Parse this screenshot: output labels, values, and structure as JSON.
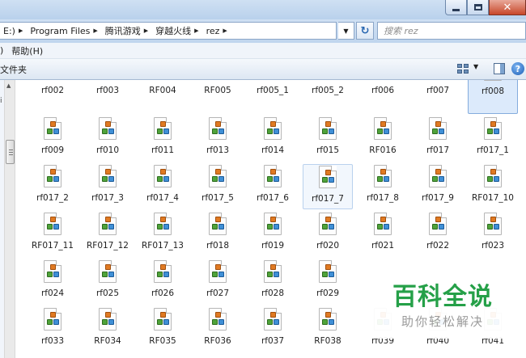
{
  "window": {
    "caption_buttons": [
      "minimize-icon",
      "maximize-icon",
      "close-icon"
    ]
  },
  "address": {
    "crumbs": [
      "E:)",
      "Program Files",
      "腾讯游戏",
      "穿越火线",
      "rez"
    ],
    "search_placeholder": "搜索 rez"
  },
  "menu": {
    "items": [
      ")",
      "帮助(H)"
    ]
  },
  "commandbar": {
    "left_label": "文件夹"
  },
  "files": {
    "rows": [
      [
        "rf002",
        "rf003",
        "RF004",
        "RF005",
        "rf005_1",
        "rf005_2",
        "rf006",
        "rf007",
        "rf008"
      ],
      [
        "rf009",
        "rf010",
        "rf011",
        "rf013",
        "rf014",
        "rf015",
        "RF016",
        "rf017",
        "rf017_1"
      ],
      [
        "rf017_2",
        "rf017_3",
        "rf017_4",
        "rf017_5",
        "rf017_6",
        "rf017_7",
        "rf017_8",
        "rf017_9",
        "RF017_10"
      ],
      [
        "RF017_11",
        "RF017_12",
        "RF017_13",
        "rf018",
        "rf019",
        "rf020",
        "rf021",
        "rf022",
        "rf023"
      ],
      [
        "rf024",
        "rf025",
        "rf026",
        "rf027",
        "rf028",
        "rf029",
        "",
        "",
        ""
      ],
      [
        "rf033",
        "RF034",
        "RF035",
        "RF036",
        "rf037",
        "RF038",
        "rf039",
        "rf040",
        "rf041"
      ]
    ],
    "selected": "rf008",
    "hovered": "rf017_7"
  },
  "watermark": {
    "title": "百科全说",
    "subtitle": "助你轻松解决"
  },
  "colors": {
    "accent": "#25a048",
    "selection": "#dceafb",
    "chrome": "#c0d5ee"
  }
}
